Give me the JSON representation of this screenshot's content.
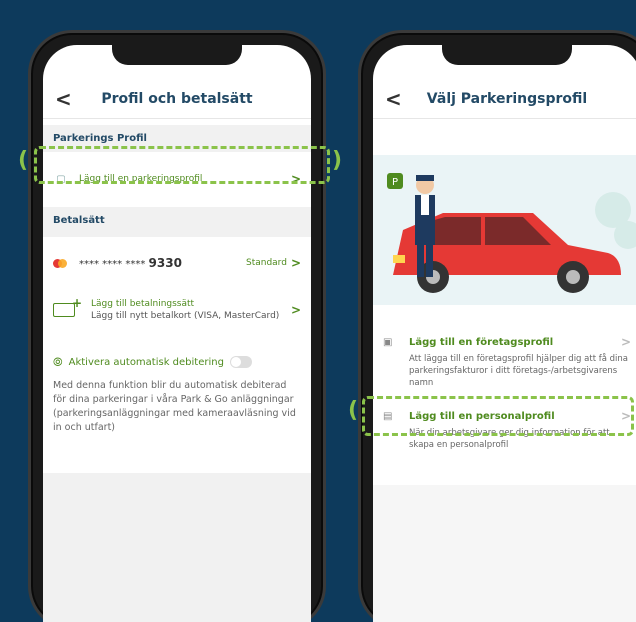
{
  "left": {
    "title": "Profil och betalsätt",
    "back": "<",
    "parking_section": "Parkerings Profil",
    "add_profile_label": "Lägg till en parkeringsprofil",
    "payment_section": "Betalsätt",
    "card_mask": "**** **** ****",
    "card_last": "9330",
    "card_default": "Standard",
    "add_card_title": "Lägg till betalningssätt",
    "add_card_subtitle": "Lägg till nytt betalkort (VISA, MasterCard)",
    "autopay_label": "Aktivera automatisk debitering",
    "autopay_desc": "Med denna funktion blir du automatisk debiterad för dina parkeringar i våra Park & Go anläggningar (parkeringsanläggningar med kameraavläsning vid in och utfart)"
  },
  "right": {
    "title": "Välj Parkeringsprofil",
    "back": "<",
    "company_label": "Lägg till en företagsprofil",
    "company_desc": "Att lägga till en företagsprofil hjälper dig att få dina parkeringsfakturor i ditt företags-/arbetsgivarens namn",
    "personal_label": "Lägg till en personalprofil",
    "personal_desc": "När din arbetsgivare ger dig information för att skapa en personalprofil"
  },
  "chevron": ">",
  "colors": {
    "background": "#0d3a5c",
    "accent": "#4f8b1f",
    "highlight": "#8bc34a",
    "title": "#234a66"
  },
  "icons": [
    "back-chevron-icon",
    "parking-card-icon",
    "mastercard-icon",
    "add-card-icon",
    "autopay-icon",
    "company-icon",
    "personal-icon",
    "chevron-right-icon"
  ]
}
